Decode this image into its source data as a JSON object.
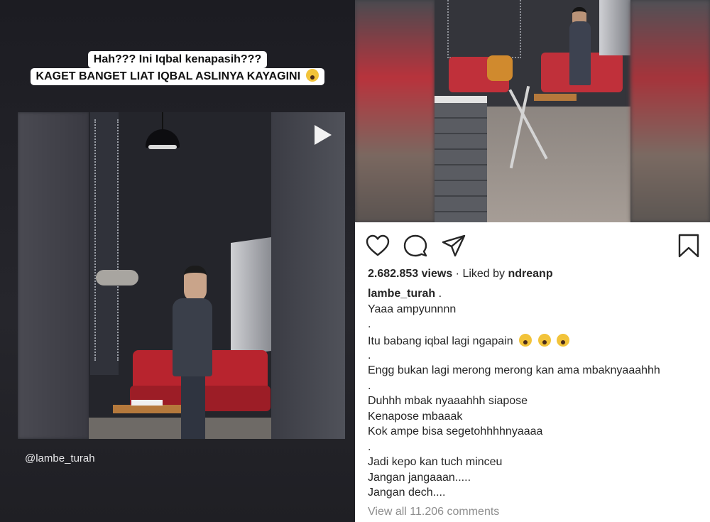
{
  "left_panel": {
    "caption_line1": "Hah??? Ini Iqbal kenapasih???",
    "caption_line2": "KAGET BANGET LIAT IQBAL ASLINYA KAYAGINI",
    "caption_emoji": "sad-face-emoji",
    "handle": "@lambe_turah",
    "play_icon": "play-icon"
  },
  "right_panel": {
    "actions": {
      "like_icon": "heart-icon",
      "comment_icon": "comment-icon",
      "share_icon": "send-icon",
      "save_icon": "bookmark-icon"
    },
    "views": "2.682.853 views",
    "liked_by_prefix": " · Liked by ",
    "liked_by_user": "ndreanp",
    "username": "lambe_turah",
    "username_suffix": " .",
    "caption_lines": [
      "Yaaa ampyunnnn",
      ".",
      "Itu babang iqbal lagi ngapain",
      ".",
      "Engg bukan lagi merong merong kan ama mbaknyaaahhh",
      ".",
      "Duhhh mbak nyaaahhh siapose",
      "Kenapose mbaaak",
      "Kok ampe bisa segetohhhhnyaaaa",
      ".",
      "Jadi kepo kan tuch minceu",
      "Jangan jangaaan.....",
      "Jangan dech...."
    ],
    "emoji_line_icon": "scream-emoji",
    "view_all_comments": "View all 11.206 comments"
  }
}
